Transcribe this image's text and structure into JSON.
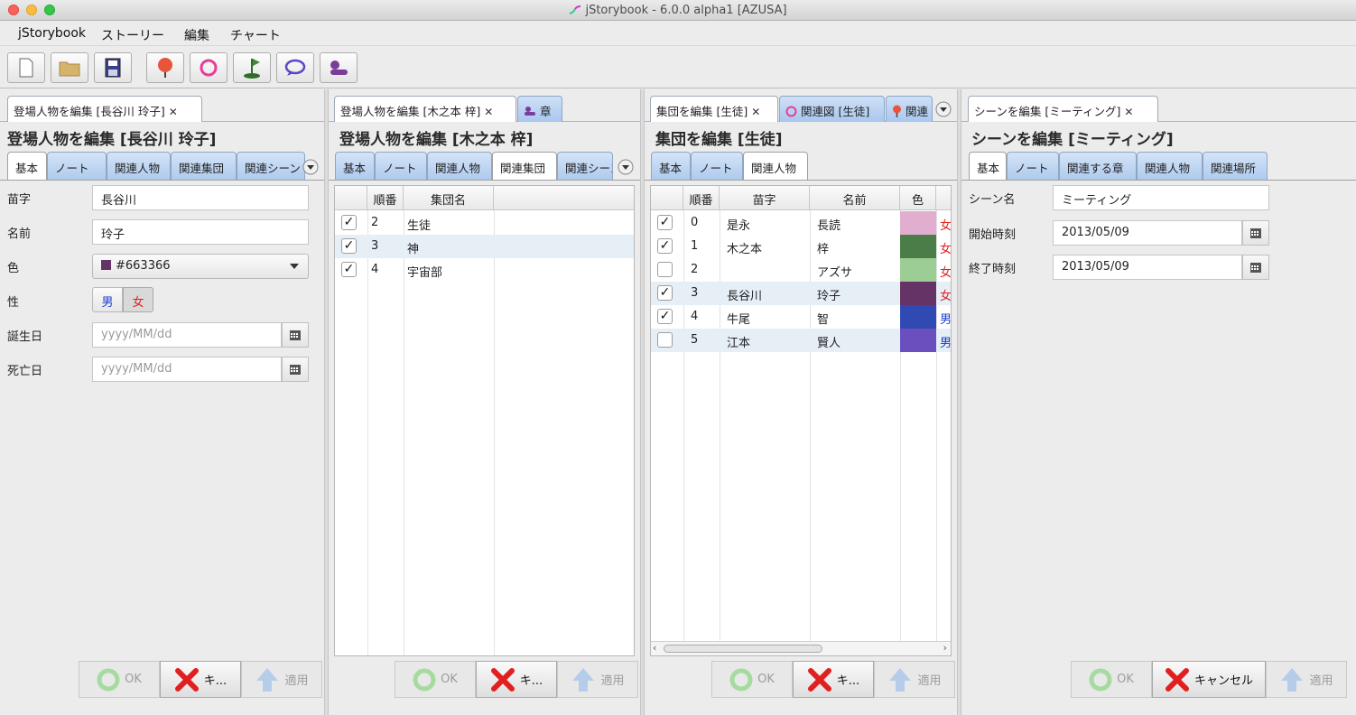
{
  "window": {
    "title": "jStorybook - 6.0.0 alpha1 [AZUSA]"
  },
  "menu": [
    "jStorybook",
    "ストーリー",
    "編集",
    "チャート"
  ],
  "toolbar": {
    "buttons": [
      "new-file-icon",
      "open-folder-icon",
      "save-icon",
      "person-pin-icon",
      "ring-icon",
      "flag-icon",
      "speech-bubble-icon",
      "chapter-icon"
    ]
  },
  "colors": {
    "red": "#e02020",
    "blue": "#1a3cd0",
    "tabBlue": "#b5cff0"
  },
  "panel1": {
    "doc_tab": "登場人物を編集 [長谷川 玲子]",
    "heading": "登場人物を編集 [長谷川 玲子]",
    "subtabs": [
      "基本",
      "ノート",
      "関連人物",
      "関連集団",
      "関連シーン"
    ],
    "form": {
      "surname_label": "苗字",
      "surname": "長谷川",
      "name_label": "名前",
      "name": "玲子",
      "color_label": "色",
      "color": "#663366",
      "sex_label": "性",
      "male": "男",
      "female": "女",
      "birth_label": "誕生日",
      "birth_placeholder": "yyyy/MM/dd",
      "death_label": "死亡日",
      "death_placeholder": "yyyy/MM/dd"
    },
    "buttons": {
      "ok": "OK",
      "cancel": "キ...",
      "apply": "適用"
    }
  },
  "panel2": {
    "doc_tabs": [
      "登場人物を編集 [木之本 梓]",
      "章"
    ],
    "heading": "登場人物を編集 [木之本 梓]",
    "subtabs": [
      "基本",
      "ノート",
      "関連人物",
      "関連集団",
      "関連シーン"
    ],
    "table": {
      "headers": [
        "",
        "順番",
        "集団名"
      ],
      "rows": [
        {
          "checked": true,
          "order": "2",
          "name": "生徒"
        },
        {
          "checked": true,
          "order": "3",
          "name": "神"
        },
        {
          "checked": true,
          "order": "4",
          "name": "宇宙部"
        }
      ]
    },
    "buttons": {
      "ok": "OK",
      "cancel": "キ...",
      "apply": "適用"
    }
  },
  "panel3": {
    "doc_tabs": [
      "集団を編集 [生徒]",
      "関連図 [生徒]",
      "関連"
    ],
    "heading": "集団を編集 [生徒]",
    "subtabs": [
      "基本",
      "ノート",
      "関連人物"
    ],
    "table": {
      "headers": [
        "",
        "順番",
        "苗字",
        "名前",
        "色"
      ],
      "rows": [
        {
          "checked": true,
          "order": "0",
          "surname": "是永",
          "name": "長読",
          "color": "#e2aed0",
          "sex": "女"
        },
        {
          "checked": true,
          "order": "1",
          "surname": "木之本",
          "name": "梓",
          "color": "#4a7d48",
          "sex": "女"
        },
        {
          "checked": false,
          "order": "2",
          "surname": "",
          "name": "アズサ",
          "color": "#9ccd94",
          "sex": "女"
        },
        {
          "checked": true,
          "order": "3",
          "surname": "長谷川",
          "name": "玲子",
          "color": "#663366",
          "sex": "女"
        },
        {
          "checked": true,
          "order": "4",
          "surname": "牛尾",
          "name": "智",
          "color": "#3149b3",
          "sex": "男"
        },
        {
          "checked": false,
          "order": "5",
          "surname": "江本",
          "name": "賢人",
          "color": "#6a4fbf",
          "sex": "男"
        }
      ]
    },
    "buttons": {
      "ok": "OK",
      "cancel": "キ...",
      "apply": "適用"
    }
  },
  "panel4": {
    "doc_tab": "シーンを編集 [ミーティング]",
    "heading": "シーンを編集 [ミーティング]",
    "subtabs": [
      "基本",
      "ノート",
      "関連する章",
      "関連人物",
      "関連場所"
    ],
    "form": {
      "scene_label": "シーン名",
      "scene": "ミーティング",
      "start_label": "開始時刻",
      "start": "2013/05/09",
      "end_label": "終了時刻",
      "end": "2013/05/09"
    },
    "buttons": {
      "ok": "OK",
      "cancel": "キャンセル",
      "apply": "適用"
    }
  }
}
